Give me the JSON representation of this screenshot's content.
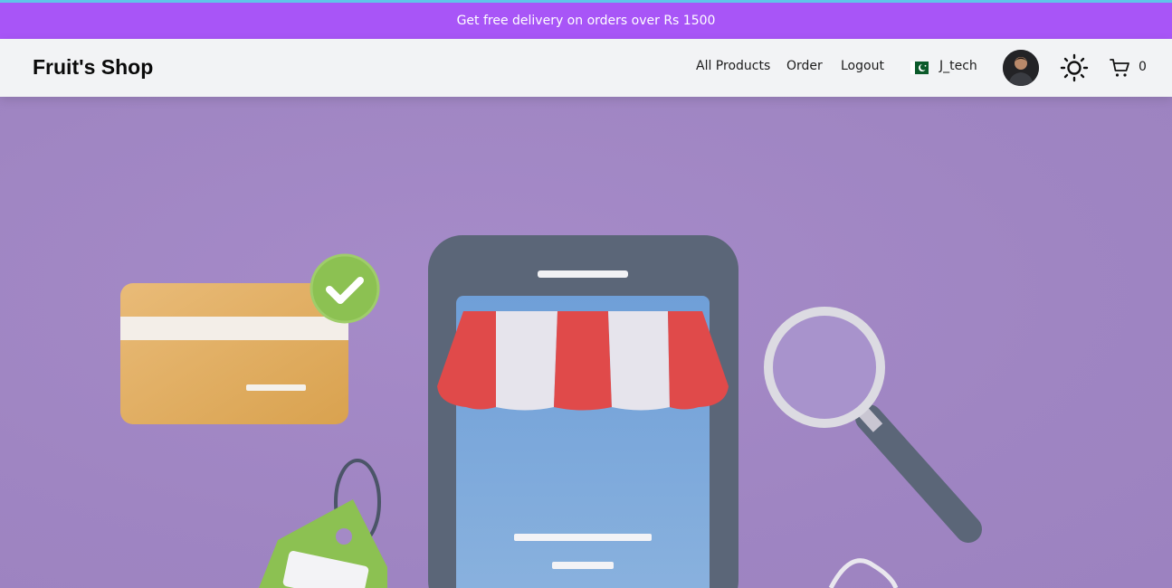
{
  "promo": {
    "text": "Get free delivery on orders over Rs 1500"
  },
  "header": {
    "brand": "Fruit's Shop",
    "nav": [
      "All Products",
      "Order",
      "Logout"
    ],
    "user_name": "J_tech",
    "cart_count": "0"
  },
  "icons": {
    "flag": "pakistan-flag-icon",
    "theme": "sun-icon",
    "cart": "cart-icon"
  },
  "colors": {
    "promo_bg": "#a855f7",
    "navbar_bg": "#f2f3f5",
    "hero_bg": "#a48ac6"
  }
}
